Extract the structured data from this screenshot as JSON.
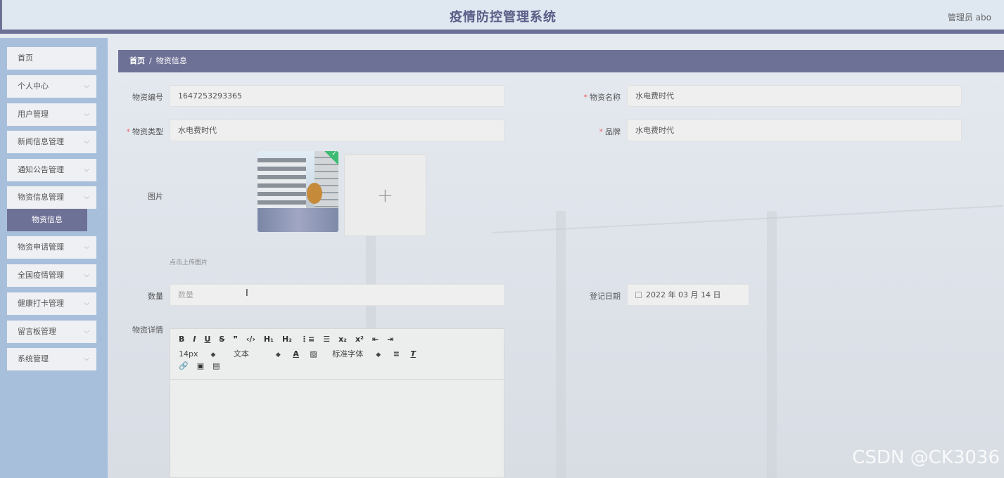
{
  "header": {
    "title": "疫情防控管理系统",
    "user": "管理员 abo"
  },
  "sidebar": {
    "items": [
      {
        "label": "首页",
        "chevron": false
      },
      {
        "label": "个人中心",
        "chevron": true
      },
      {
        "label": "用户管理",
        "chevron": true
      },
      {
        "label": "新闻信息管理",
        "chevron": true
      },
      {
        "label": "通知公告管理",
        "chevron": true
      },
      {
        "label": "物资信息管理",
        "chevron": true
      },
      {
        "label": "物资申请管理",
        "chevron": true
      },
      {
        "label": "全国疫情管理",
        "chevron": true
      },
      {
        "label": "健康打卡管理",
        "chevron": true
      },
      {
        "label": "留言板管理",
        "chevron": true
      },
      {
        "label": "系统管理",
        "chevron": true
      }
    ],
    "active_sub": "物资信息"
  },
  "breadcrumb": {
    "home": "首页",
    "separator": "/",
    "current": "物资信息"
  },
  "form": {
    "code_label": "物资编号",
    "code_value": "1647253293365",
    "name_label": "物资名称",
    "name_value": "水电费时代",
    "type_label": "物资类型",
    "type_value": "水电费时代",
    "brand_label": "品牌",
    "brand_value": "水电费时代",
    "image_label": "图片",
    "upload_hint": "点击上传图片",
    "upload_plus": "+",
    "qty_label": "数量",
    "qty_placeholder": "数量",
    "date_label": "登记日期",
    "date_value": "2022 年 03 月 14 日",
    "detail_label": "物资详情",
    "required_mark": "*"
  },
  "editor": {
    "row1": [
      "B",
      "I",
      "U",
      "S",
      "❞",
      "‹/›",
      "H₁",
      "H₂",
      "⋮≡",
      "☰",
      "x₂",
      "x²",
      "⇤",
      "⇥"
    ],
    "font_size": "14px",
    "block": "文本",
    "font_family": "标准字体",
    "row3": [
      "🔗",
      "▣",
      "▤"
    ]
  },
  "watermark": "CSDN @CK3036"
}
